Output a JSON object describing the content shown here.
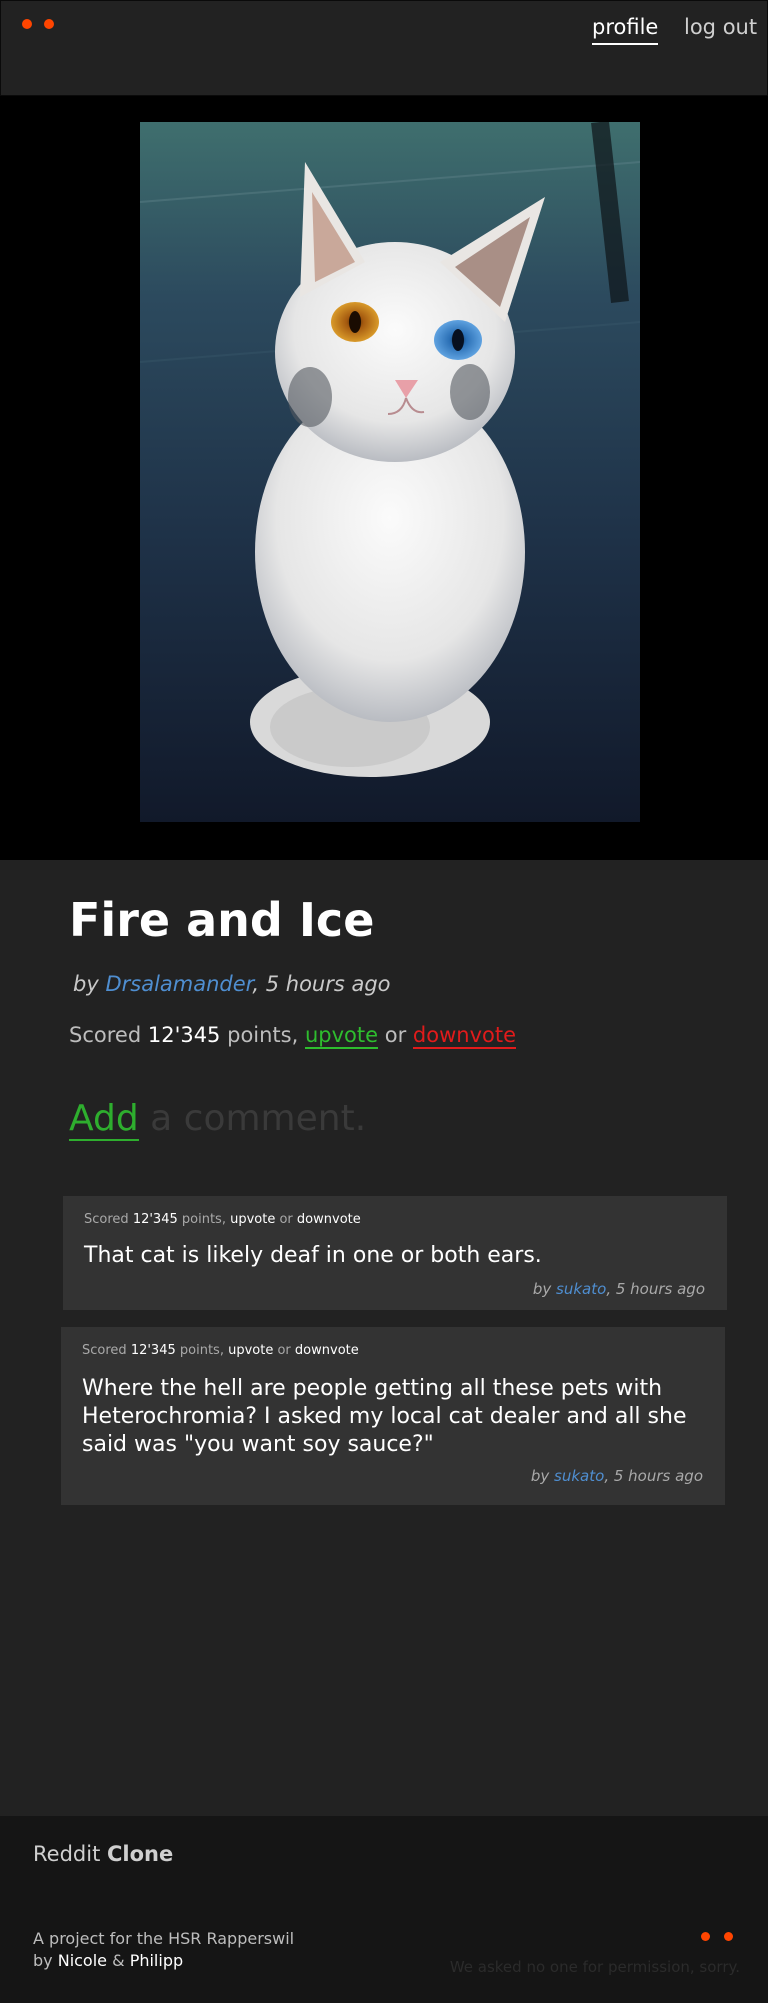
{
  "header": {
    "nav": {
      "profile": "profile",
      "logout": "log out"
    },
    "accent_color": "#ff4500"
  },
  "post": {
    "image_description": "white long-haired cat with heterochromia (one orange eye, one blue eye) sitting on blue pavement",
    "title": "Fire and Ice",
    "by_label": "by",
    "author": "Drsalamander",
    "time": ", 5 hours ago",
    "score_prefix": "Scored",
    "score": "12'345",
    "score_suffix": "points,",
    "upvote": "upvote",
    "or": "or",
    "downvote": "downvote"
  },
  "add_comment": {
    "add": "Add",
    "rest": "a comment."
  },
  "comments": [
    {
      "score_prefix": "Scored",
      "score": "12'345",
      "score_suffix": "points,",
      "upvote": "upvote",
      "or": "or",
      "downvote": "downvote",
      "text": "That cat is likely deaf in one or both ears.",
      "by_label": "by",
      "author": "sukato",
      "time": ", 5 hours ago"
    },
    {
      "score_prefix": "Scored",
      "score": "12'345",
      "score_suffix": "points,",
      "upvote": "upvote",
      "or": "or",
      "downvote": "downvote",
      "text": "Where the hell are people getting all these pets with Heterochromia? I asked my local cat dealer and all she said was \"you want soy sauce?\"",
      "by_label": "by",
      "author": "sukato",
      "time": ", 5 hours ago"
    }
  ],
  "footer": {
    "brand_light": "Reddit",
    "brand_bold": "Clone",
    "project_line": "A project for the HSR Rapperswil",
    "by_label": "by",
    "author1": "Nicole",
    "amp": "&",
    "author2": "Philipp",
    "note": "We asked no one for permission, sorry."
  }
}
